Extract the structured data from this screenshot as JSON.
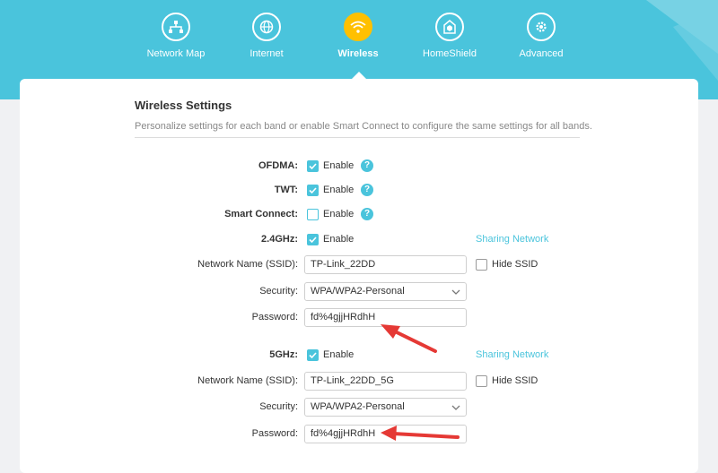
{
  "nav": [
    {
      "label": "Network Map",
      "icon": "network-map-icon"
    },
    {
      "label": "Internet",
      "icon": "globe-icon"
    },
    {
      "label": "Wireless",
      "icon": "wifi-icon",
      "active": true
    },
    {
      "label": "HomeShield",
      "icon": "home-shield-icon"
    },
    {
      "label": "Advanced",
      "icon": "gear-icon"
    }
  ],
  "section": {
    "title": "Wireless Settings",
    "description": "Personalize settings for each band or enable Smart Connect to configure the same settings for all bands."
  },
  "features": [
    {
      "label": "OFDMA:",
      "checked": true,
      "text": "Enable"
    },
    {
      "label": "TWT:",
      "checked": true,
      "text": "Enable"
    },
    {
      "label": "Smart Connect:",
      "checked": false,
      "text": "Enable"
    }
  ],
  "band24": {
    "label": "2.4GHz:",
    "checked": true,
    "enable_text": "Enable",
    "sharing_link": "Sharing Network",
    "ssid_label": "Network Name (SSID):",
    "ssid_value": "TP-Link_22DD",
    "hide_ssid": "Hide SSID",
    "security_label": "Security:",
    "security_value": "WPA/WPA2-Personal",
    "password_label": "Password:",
    "password_value": "fd%4gjjHRdhH"
  },
  "band5": {
    "label": "5GHz:",
    "checked": true,
    "enable_text": "Enable",
    "sharing_link": "Sharing Network",
    "ssid_label": "Network Name (SSID):",
    "ssid_value": "TP-Link_22DD_5G",
    "hide_ssid": "Hide SSID",
    "security_label": "Security:",
    "security_value": "WPA/WPA2-Personal",
    "password_label": "Password:",
    "password_value": "fd%4gjjHRdhH"
  },
  "colors": {
    "header": "#4ac4dc",
    "active_nav": "#ffc000",
    "accent": "#4ac4dc",
    "annotation_arrow": "#e53935"
  }
}
